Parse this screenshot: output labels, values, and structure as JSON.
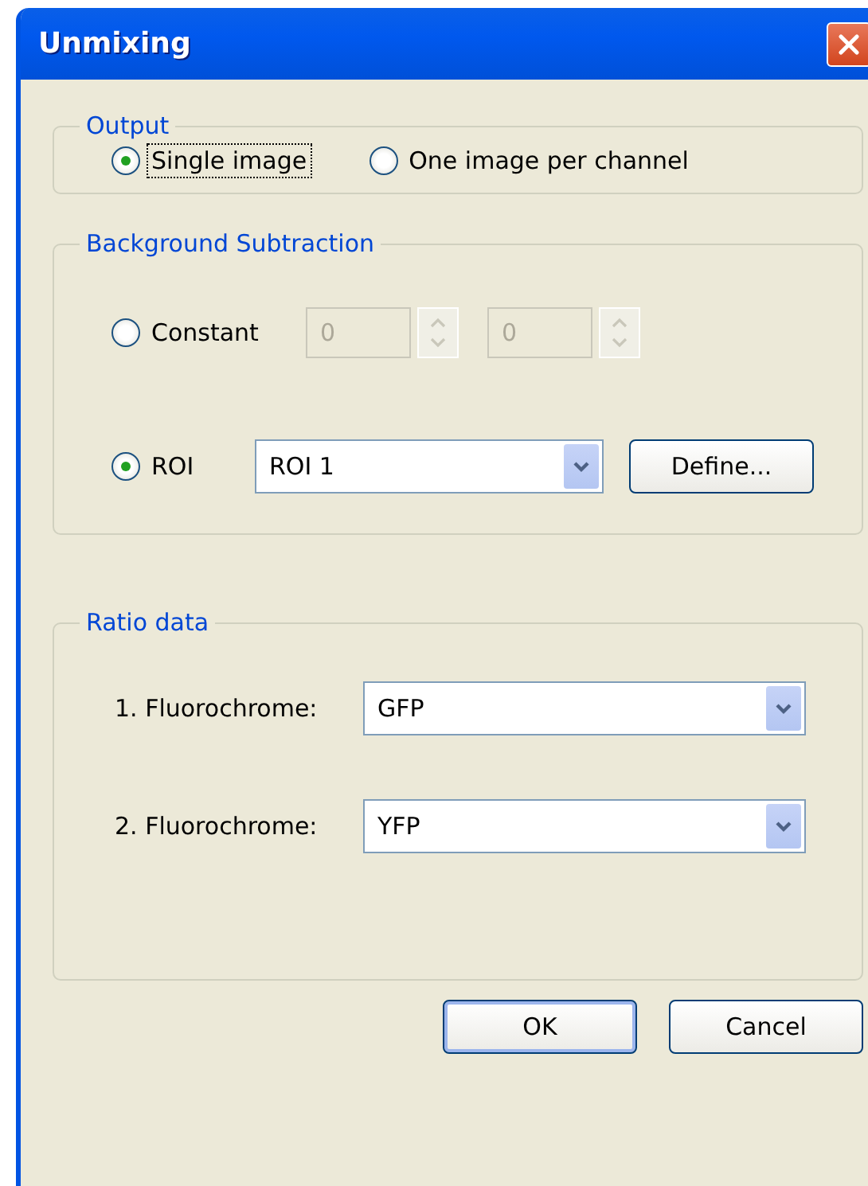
{
  "window": {
    "title": "Unmixing"
  },
  "output": {
    "title": "Output",
    "options": [
      {
        "label": "Single image",
        "selected": true,
        "focused": true
      },
      {
        "label": "One image per channel",
        "selected": false,
        "focused": false
      }
    ]
  },
  "background_subtraction": {
    "title": "Background Subtraction",
    "options": [
      {
        "kind": "constant",
        "label": "Constant",
        "selected": false,
        "fields": [
          {
            "value": "0",
            "disabled": true
          },
          {
            "value": "0",
            "disabled": true
          }
        ]
      },
      {
        "kind": "roi",
        "label": "ROI",
        "selected": true,
        "dropdown": {
          "value": "ROI 1"
        },
        "button": "Define..."
      }
    ]
  },
  "ratio_data": {
    "title": "Ratio data",
    "rows": [
      {
        "label": "1. Fluorochrome:",
        "value": "GFP"
      },
      {
        "label": "2. Fluorochrome:",
        "value": "YFP"
      }
    ]
  },
  "buttons": [
    {
      "label": "OK",
      "default": true
    },
    {
      "label": "Cancel",
      "default": false
    }
  ]
}
